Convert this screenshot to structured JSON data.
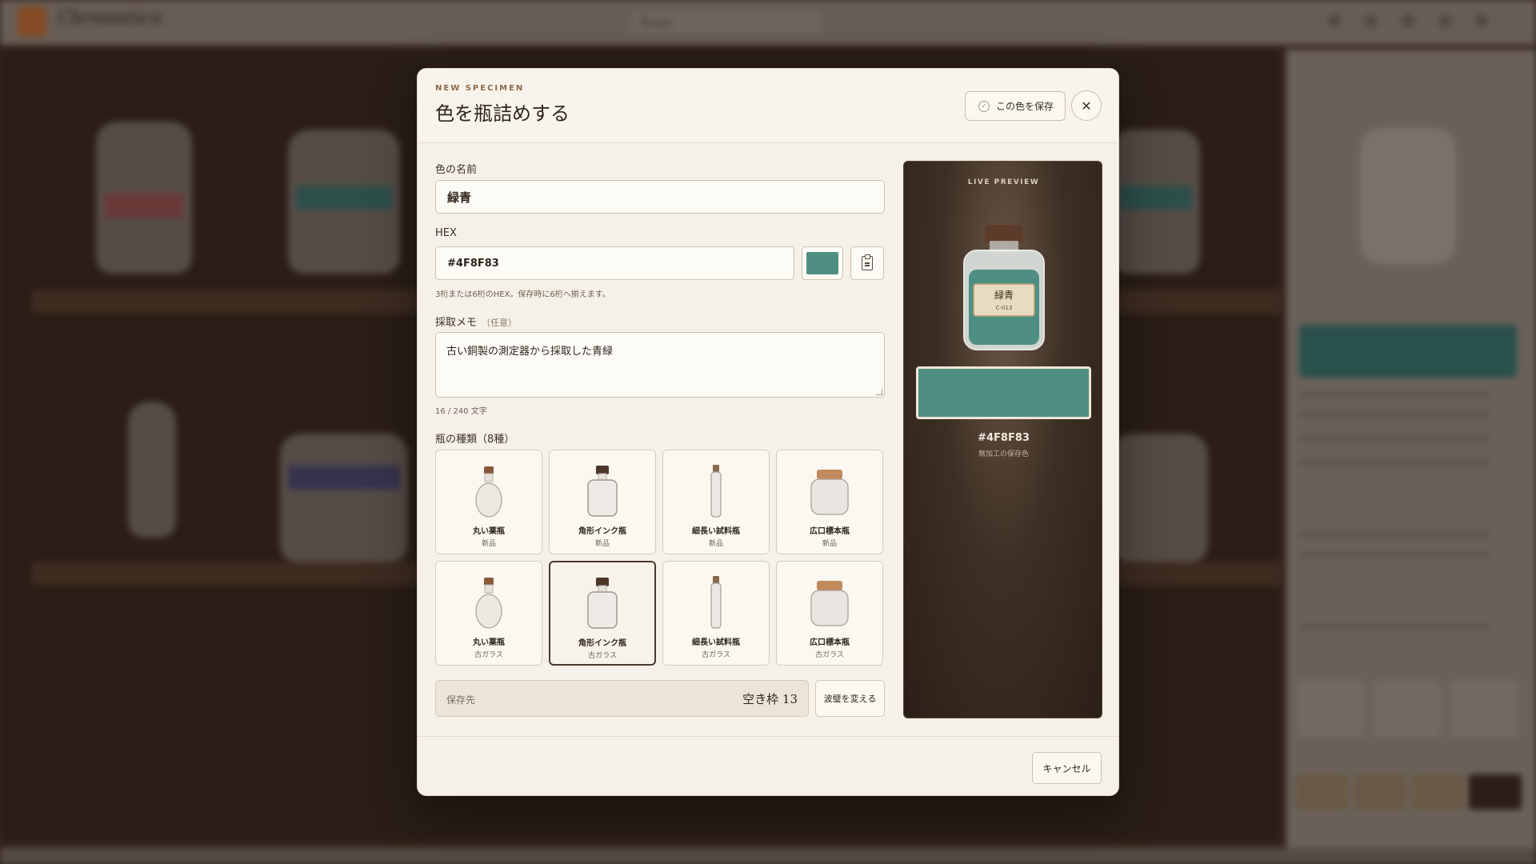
{
  "background_app": {
    "brand": "Chromatica",
    "search": "Scan"
  },
  "modal": {
    "eyebrow": "NEW SPECIMEN",
    "title": "色を瓶詰めする",
    "save_label": "この色を保存",
    "close_icon": "close-icon",
    "name_field": {
      "label": "色の名前",
      "value": "緑青"
    },
    "hex_field": {
      "label": "HEX",
      "value": "#4F8F83",
      "hint": "3桁または6桁のHEX。保存時に6桁へ揃えます。"
    },
    "memo_field": {
      "label": "採取メモ",
      "optional": "（任意）",
      "value": "古い銅製の測定器から採取した青緑",
      "counter": "16 / 240 文字"
    },
    "bottle_section": {
      "label": "瓶の種類（8種）",
      "items": [
        {
          "name": "丸い薬瓶",
          "variant": "新品",
          "shape": "round",
          "selected": false
        },
        {
          "name": "角形インク瓶",
          "variant": "新品",
          "shape": "square",
          "selected": false
        },
        {
          "name": "細長い試料瓶",
          "variant": "新品",
          "shape": "tall",
          "selected": false
        },
        {
          "name": "広口標本瓶",
          "variant": "新品",
          "shape": "wide",
          "selected": false
        },
        {
          "name": "丸い薬瓶",
          "variant": "古ガラス",
          "shape": "round",
          "selected": false
        },
        {
          "name": "角形インク瓶",
          "variant": "古ガラス",
          "shape": "square",
          "selected": true
        },
        {
          "name": "細長い試料瓶",
          "variant": "古ガラス",
          "shape": "tall",
          "selected": false
        },
        {
          "name": "広口標本瓶",
          "variant": "古ガラス",
          "shape": "wide",
          "selected": false
        }
      ]
    },
    "destination": {
      "label": "保存先",
      "value": "空き枠 13"
    },
    "change_shelf_label": "波璧を変える",
    "cancel_label": "キャンセル",
    "preview": {
      "eyebrow": "LIVE PREVIEW",
      "bottle_label": "緑青",
      "bottle_code": "C-013",
      "hex": "#4F8F83",
      "note": "無加工の保存色"
    }
  },
  "colors": {
    "specimen": "#4F8F83",
    "accent_brown": "#3e2f24",
    "modal_bg": "#f6f1e8"
  }
}
